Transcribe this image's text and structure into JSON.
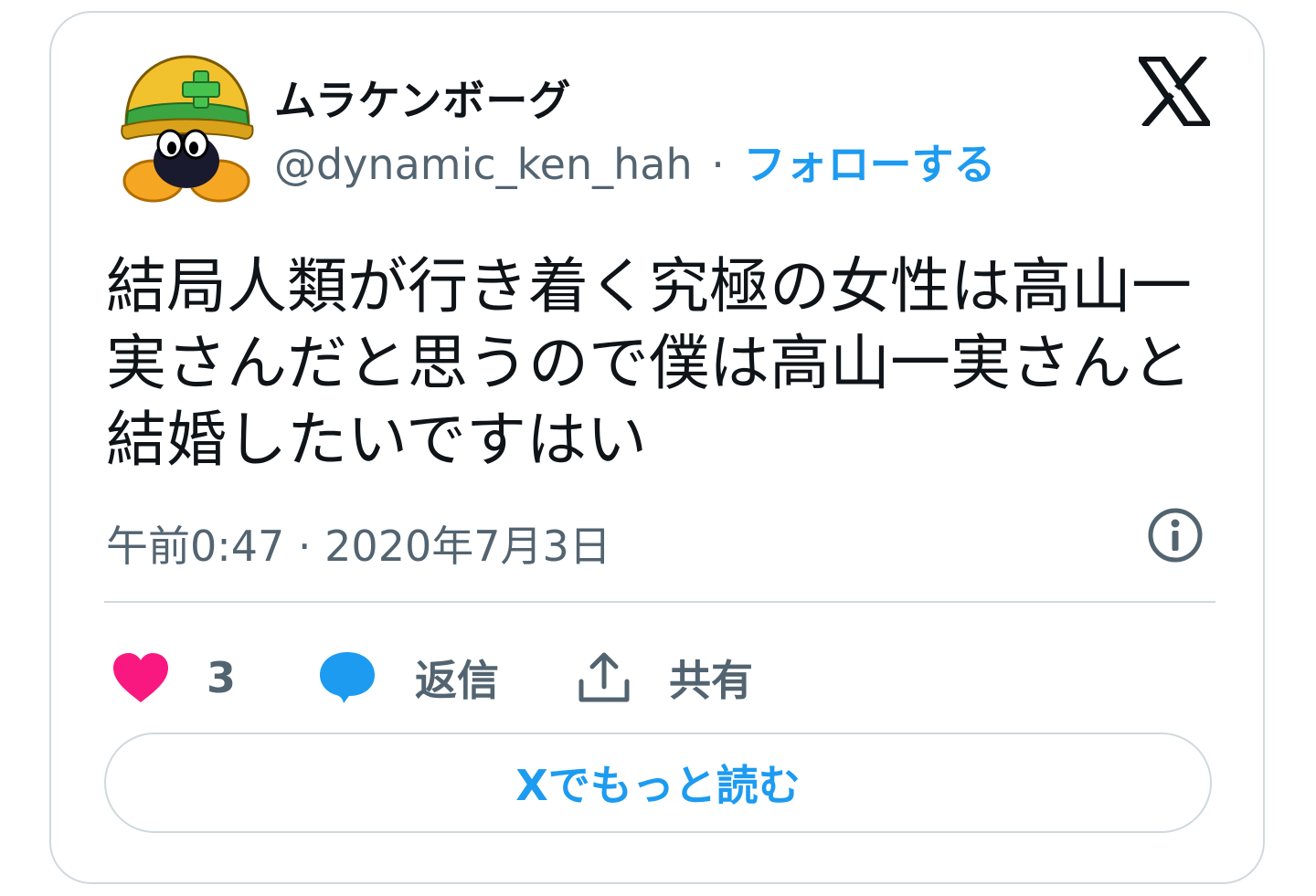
{
  "user": {
    "display_name": "ムラケンボーグ",
    "handle": "@dynamic_ken_hah",
    "separator": "·",
    "follow_label": "フォローする"
  },
  "tweet": {
    "text": "結局人類が行き着く究極の女性は高山一実さんだと思うので僕は高山一実さんと結婚したいですはい",
    "timestamp": "午前0:47 · 2020年7月3日"
  },
  "actions": {
    "like_count": "3",
    "reply_label": "返信",
    "share_label": "共有"
  },
  "read_more_label": "Xでもっと読む",
  "colors": {
    "accent": "#1d9bf0",
    "like": "#f91880",
    "text_primary": "#0f1419",
    "text_secondary": "#536471",
    "border": "#cfd9de"
  },
  "icons": {
    "avatar": "helmet-character-avatar",
    "brand": "x-logo-icon",
    "info": "info-icon",
    "like": "heart-icon",
    "reply": "speech-bubble-icon",
    "share": "share-upload-icon"
  }
}
